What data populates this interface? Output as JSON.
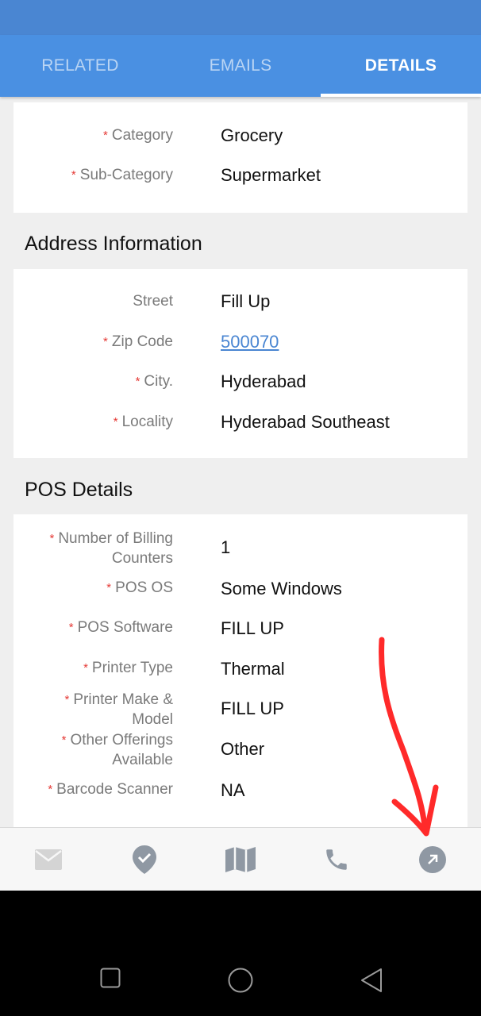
{
  "tabs": [
    {
      "label": "RELATED",
      "active": false
    },
    {
      "label": "EMAILS",
      "active": false
    },
    {
      "label": "DETAILS",
      "active": true
    }
  ],
  "category_card": {
    "category_label": "Category",
    "category_value": "Grocery",
    "subcategory_label": "Sub-Category",
    "subcategory_value": "Supermarket"
  },
  "address": {
    "title": "Address Information",
    "street_label": "Street",
    "street_value": "Fill Up",
    "zip_label": "Zip Code",
    "zip_value": "500070",
    "city_label": "City.",
    "city_value": "Hyderabad",
    "locality_label": "Locality",
    "locality_value": "Hyderabad Southeast"
  },
  "pos": {
    "title": "POS Details",
    "billing_label_line1": "Number of Billing",
    "billing_label_line2": "Counters",
    "billing_value": "1",
    "os_label": "POS OS",
    "os_value": "Some Windows",
    "software_label": "POS Software",
    "software_value": "FILL UP",
    "printer_type_label": "Printer Type",
    "printer_type_value": "Thermal",
    "printer_make_label_line1": "Printer Make &",
    "printer_make_label_line2": "Model",
    "printer_make_value": "FILL UP",
    "other_label_line1": "Other Offerings",
    "other_label_line2": "Available",
    "other_value": "Other",
    "barcode_label": "Barcode Scanner",
    "barcode_value": "NA"
  },
  "required_marker": "*",
  "bottom_nav": {
    "icons": [
      "mail-icon",
      "check-badge-icon",
      "map-icon",
      "phone-icon",
      "open-external-icon"
    ]
  },
  "colors": {
    "header_blue": "#4a90e2",
    "status_blue": "#4a86d2",
    "required_red": "#e53935",
    "annotation_red": "#ff2a2a"
  }
}
